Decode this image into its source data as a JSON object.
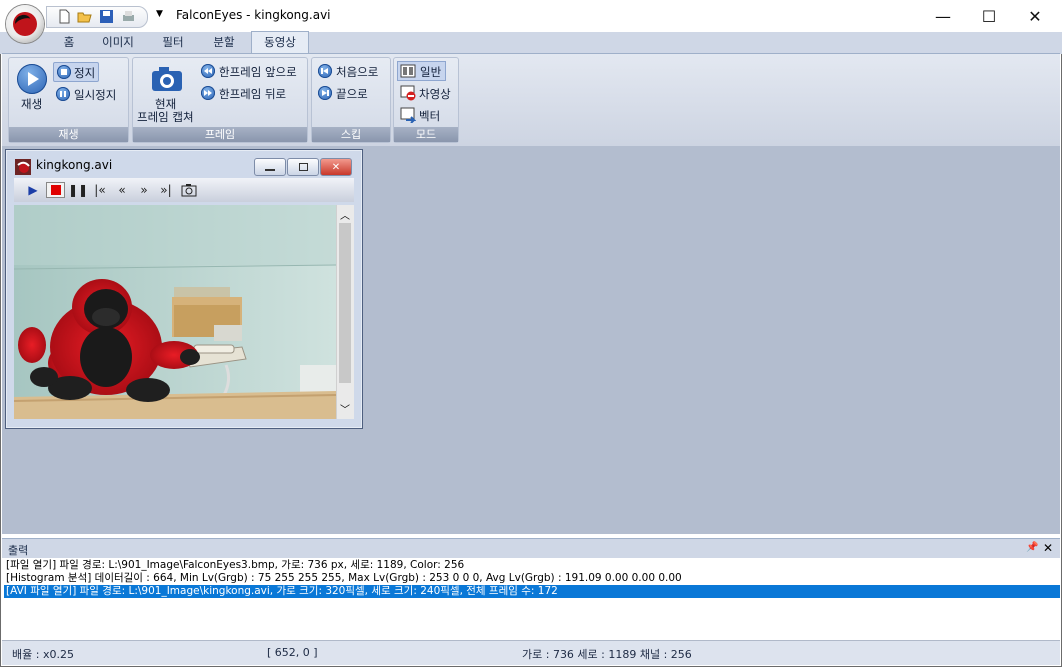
{
  "title": "FalconEyes - kingkong.avi",
  "window_controls": {
    "minimize": "—",
    "maximize": "☐",
    "close": "✕"
  },
  "tabs": [
    "홈",
    "이미지",
    "필터",
    "분할",
    "동영상"
  ],
  "active_tab": "동영상",
  "ribbon": {
    "play_group": {
      "label": "재생",
      "play": "재생",
      "stop": "정지",
      "pause": "일시정지"
    },
    "frame_group": {
      "label": "프레임",
      "capture_line1": "현재",
      "capture_line2": "프레임 캡쳐",
      "prev": "한프레임 앞으로",
      "next": "한프레임 뒤로"
    },
    "skip_group": {
      "label": "스킵",
      "first": "처음으로",
      "last": "끝으로"
    },
    "mode_group": {
      "label": "모드",
      "normal": "일반",
      "diff": "차영상",
      "vector": "벡터"
    }
  },
  "child_window": {
    "title": "kingkong.avi"
  },
  "output": {
    "title": "출력",
    "pin": "📌",
    "close": "✕",
    "lines": [
      "[파일 열기] 파일 경로: L:\\901_Image\\FalconEyes3.bmp, 가로: 736 px, 세로: 1189, Color: 256",
      "[Histogram 분석] 데이터길이 : 664, Min Lv(Grgb) : 75 255 255 255, Max Lv(Grgb) : 253 0 0 0, Avg Lv(Grgb) : 191.09 0.00 0.00 0.00",
      "[AVI 파일 열기] 파일 경로: L:\\901_Image\\kingkong.avi, 가로 크기: 320픽셀, 세로 크기: 240픽셀, 전체 프레임 수: 172"
    ]
  },
  "status": {
    "zoom": "배율 : x0.25",
    "coords": "[ 652, 0 ]",
    "info": "가로 : 736  세로 : 1189  채널 : 256"
  },
  "colors": {
    "accent": "#0a78d7",
    "workspace": "#b3bdcf",
    "ribbon": "#dfe5ef"
  }
}
